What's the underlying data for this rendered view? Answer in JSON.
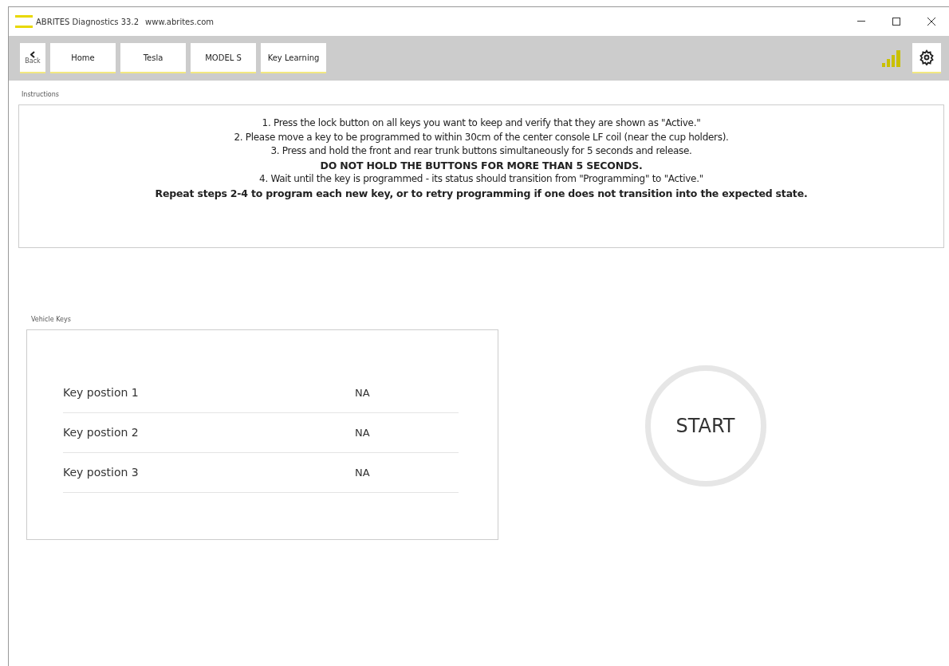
{
  "window": {
    "title": "ABRITES Diagnostics 33.2",
    "url": "www.abrites.com"
  },
  "breadcrumbs": [
    {
      "label": "Back",
      "kind": "back"
    },
    {
      "label": "Home",
      "kind": "crumb"
    },
    {
      "label": "Tesla",
      "kind": "crumb"
    },
    {
      "label": "MODEL S",
      "kind": "crumb"
    },
    {
      "label": "Key Learning",
      "kind": "crumb"
    }
  ],
  "instructions": {
    "label": "Instructions",
    "lines": [
      {
        "text": "1. Press the lock button on all keys you want to keep and verify that they are shown as \"Active.\"",
        "bold": false
      },
      {
        "text": "2. Please move a key to be programmed to within 30cm of the center console LF coil (near the cup holders).",
        "bold": false
      },
      {
        "text": "3. Press and hold the front and rear trunk buttons simultaneously for 5 seconds and release.",
        "bold": false
      },
      {
        "text": "DO NOT HOLD THE BUTTONS FOR MORE THAN 5 SECONDS.",
        "bold": true
      },
      {
        "text": "4. Wait until the key is programmed - its status should transition from \"Programming\" to \"Active.\"",
        "bold": false
      },
      {
        "text": "Repeat steps 2-4 to program each new key, or to retry programming if one does not transition into the expected state.",
        "bold": true
      }
    ]
  },
  "vehicle_keys": {
    "label": "Vehicle Keys",
    "keys": [
      {
        "name": "Key postion 1",
        "status": "NA"
      },
      {
        "name": "Key postion 2",
        "status": "NA"
      },
      {
        "name": "Key postion 3",
        "status": "NA"
      }
    ]
  },
  "start_button": "START"
}
